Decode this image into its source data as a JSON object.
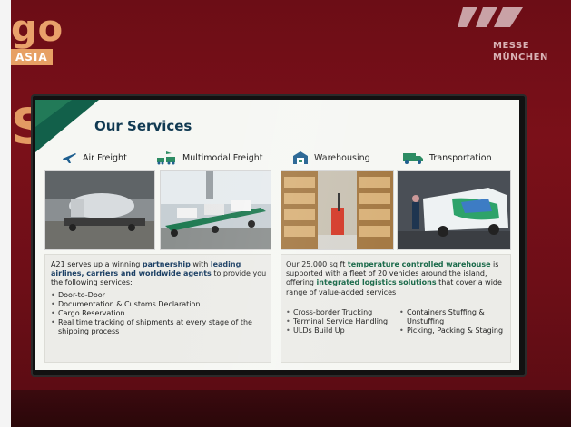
{
  "event_brand": {
    "name": "go",
    "region": "ASIA",
    "partial_letter": "S"
  },
  "venue_brand": {
    "line1": "MESSE",
    "line2": "MÜNCHEN"
  },
  "slide": {
    "title": "Our Services",
    "services": [
      {
        "label": "Air Freight",
        "icon": "airplane-icon"
      },
      {
        "label": "Multimodal Freight",
        "icon": "multimodal-icon"
      },
      {
        "label": "Warehousing",
        "icon": "warehouse-icon"
      },
      {
        "label": "Transportation",
        "icon": "truck-icon"
      }
    ],
    "left_panel": {
      "intro_1": "A21 serves up a winning ",
      "intro_b1": "partnership",
      "intro_2": " with ",
      "intro_b2": "leading airlines, carriers and worldwide agents",
      "intro_3": " to provide you the following services:",
      "items": [
        "Door-to-Door",
        "Documentation & Customs Declaration",
        "Cargo Reservation",
        "Real time tracking of shipments at every stage of the shipping process"
      ]
    },
    "right_panel": {
      "intro_1": "Our 25,000 sq ft ",
      "intro_b1": "temperature controlled warehouse",
      "intro_2": " is supported with a fleet of 20 vehicles around the island, offering ",
      "intro_b2": "integrated logistics solutions",
      "intro_3": " that cover a wide range of value-added services",
      "items_col1": [
        "Cross-border Trucking",
        "Terminal Service Handling",
        "ULDs Build Up"
      ],
      "items_col2": [
        "Containers Stuffing & Unstuffing",
        "Picking, Packing & Staging"
      ]
    }
  },
  "colors": {
    "wall": "#6c0d16",
    "accent_green": "#12604a",
    "title_navy": "#113a52",
    "highlight_green": "#1a6a4a",
    "icon_blue": "#1f5f8f"
  }
}
